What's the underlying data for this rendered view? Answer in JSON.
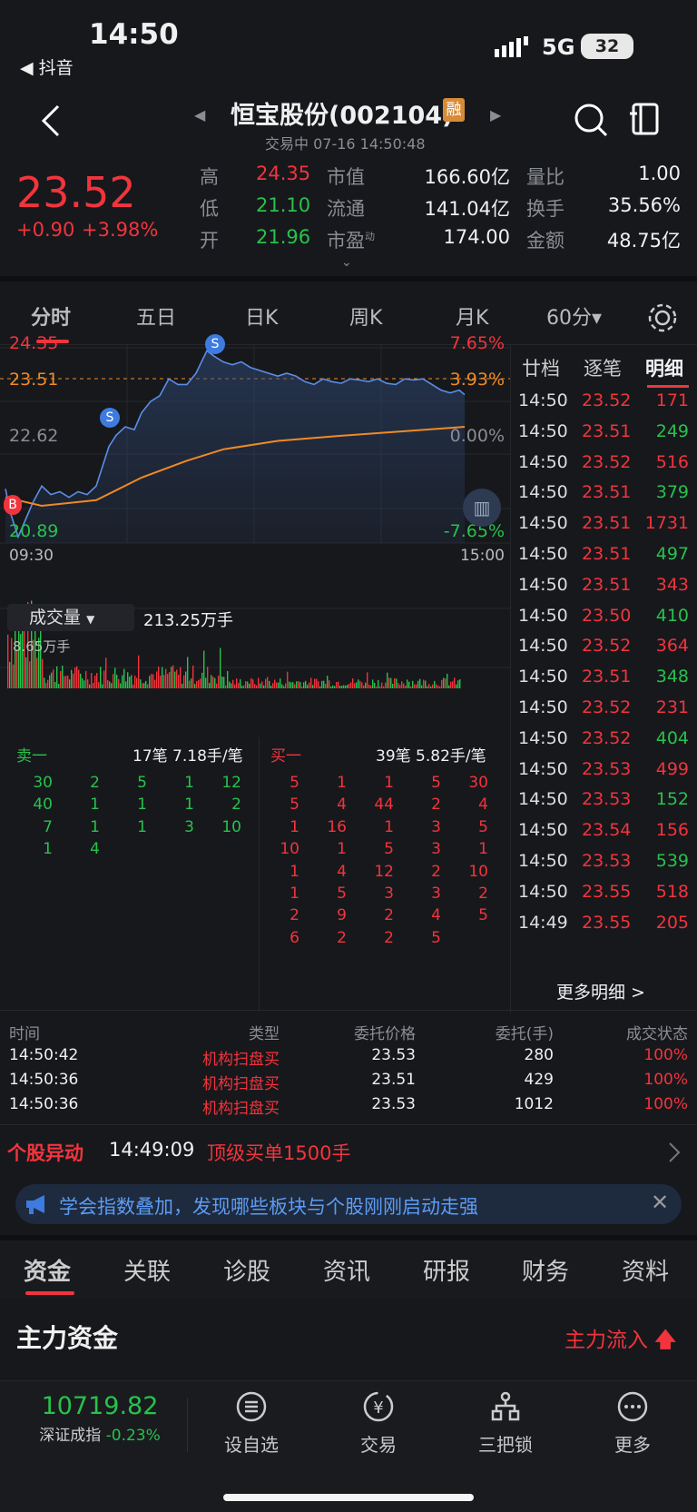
{
  "status_bar": {
    "time": "14:50",
    "back_app": "抖音",
    "network": "5G",
    "battery": "32"
  },
  "nav": {
    "title": "恒宝股份(002104)",
    "badge": "融",
    "subtitle": "交易中 07-16 14:50:48"
  },
  "quote": {
    "price": "23.52",
    "change": "+0.90",
    "change_pct": "+3.98%",
    "stats": [
      {
        "l1": "高",
        "v1": "24.35",
        "l2": "市值",
        "v2": "166.60亿",
        "l3": "量比",
        "v3": "1.00"
      },
      {
        "l1": "低",
        "v1": "21.10",
        "l2": "流通",
        "v2": "141.04亿",
        "l3": "换手",
        "v3": "35.56%"
      },
      {
        "l1": "开",
        "v1": "21.96",
        "l2": "市盈",
        "l2sup": "动",
        "v2": "174.00",
        "l3": "金额",
        "v3": "48.75亿"
      }
    ]
  },
  "chart_tabs": [
    "分时",
    "五日",
    "日K",
    "周K",
    "月K",
    "60分▾"
  ],
  "chart": {
    "price_labels": {
      "high": "24.35",
      "mid": "23.51",
      "base": "22.62",
      "low": "20.89"
    },
    "pct_labels": {
      "high": "7.65%",
      "mid": "3.93%",
      "base": "0.00%",
      "low": "-7.65%"
    },
    "time_start": "09:30",
    "time_end": "15:00",
    "marker_s": "S",
    "marker_b": "B",
    "volume_label": "成交量",
    "volume_value": "213.25万手",
    "volume_max": "8.65万手",
    "colors": {
      "up": "#f2343c",
      "down": "#27c24c",
      "price_line": "#5b8ee6",
      "avg_line": "#f08a24"
    }
  },
  "order_book": {
    "sell_label": "卖一",
    "sell_summary": "17笔 7.18手/笔",
    "buy_label": "买一",
    "buy_summary": "39笔 5.82手/笔",
    "sell_rows": [
      [
        "30",
        "2",
        "5",
        "1",
        "12"
      ],
      [
        "40",
        "1",
        "1",
        "1",
        "2"
      ],
      [
        "7",
        "1",
        "1",
        "3",
        "10"
      ],
      [
        "1",
        "4",
        "",
        "",
        ""
      ]
    ],
    "buy_rows": [
      [
        "5",
        "1",
        "1",
        "5",
        "30"
      ],
      [
        "5",
        "4",
        "44",
        "2",
        "4"
      ],
      [
        "1",
        "16",
        "1",
        "3",
        "5"
      ],
      [
        "10",
        "1",
        "5",
        "3",
        "1"
      ],
      [
        "1",
        "4",
        "12",
        "2",
        "10"
      ],
      [
        "1",
        "5",
        "3",
        "3",
        "2"
      ],
      [
        "2",
        "9",
        "2",
        "4",
        "5"
      ],
      [
        "6",
        "2",
        "2",
        "5",
        ""
      ]
    ]
  },
  "detail_tabs": [
    "廿档",
    "逐笔",
    "明细"
  ],
  "trade_detail": [
    {
      "t": "14:50",
      "p": "23.52",
      "v": "171"
    },
    {
      "t": "14:50",
      "p": "23.51",
      "v": "249"
    },
    {
      "t": "14:50",
      "p": "23.52",
      "v": "516"
    },
    {
      "t": "14:50",
      "p": "23.51",
      "v": "379"
    },
    {
      "t": "14:50",
      "p": "23.51",
      "v": "1731"
    },
    {
      "t": "14:50",
      "p": "23.51",
      "v": "497"
    },
    {
      "t": "14:50",
      "p": "23.51",
      "v": "343"
    },
    {
      "t": "14:50",
      "p": "23.50",
      "v": "410"
    },
    {
      "t": "14:50",
      "p": "23.52",
      "v": "364"
    },
    {
      "t": "14:50",
      "p": "23.51",
      "v": "348"
    },
    {
      "t": "14:50",
      "p": "23.52",
      "v": "231"
    },
    {
      "t": "14:50",
      "p": "23.52",
      "v": "404"
    },
    {
      "t": "14:50",
      "p": "23.53",
      "v": "499"
    },
    {
      "t": "14:50",
      "p": "23.53",
      "v": "152"
    },
    {
      "t": "14:50",
      "p": "23.54",
      "v": "156"
    },
    {
      "t": "14:50",
      "p": "23.53",
      "v": "539"
    },
    {
      "t": "14:50",
      "p": "23.55",
      "v": "518"
    },
    {
      "t": "14:49",
      "p": "23.55",
      "v": "205"
    }
  ],
  "more_detail": "更多明细 >",
  "orders": {
    "headers": [
      "时间",
      "类型",
      "委托价格",
      "委托(手)",
      "成交状态"
    ],
    "rows": [
      [
        "14:50:42",
        "机构扫盘买",
        "23.53",
        "280",
        "100%"
      ],
      [
        "14:50:36",
        "机构扫盘买",
        "23.51",
        "429",
        "100%"
      ],
      [
        "14:50:36",
        "机构扫盘买",
        "23.53",
        "1012",
        "100%"
      ]
    ]
  },
  "alert": {
    "label": "个股异动",
    "time": "14:49:09",
    "text": "顶级买单1500手"
  },
  "banner": {
    "text": "学会指数叠加，发现哪些板块与个股刚刚启动走强"
  },
  "bottom_tabs": [
    "资金",
    "关联",
    "诊股",
    "资讯",
    "研报",
    "财务",
    "资料"
  ],
  "capital": {
    "title": "主力资金",
    "inflow": "主力流入"
  },
  "index": {
    "value": "10719.82",
    "name": "深证成指",
    "change": "-0.23%"
  },
  "bottom_nav": [
    {
      "label": "设自选",
      "icon": "menu-icon"
    },
    {
      "label": "交易",
      "icon": "yen-icon"
    },
    {
      "label": "三把锁",
      "icon": "network-icon"
    },
    {
      "label": "更多",
      "icon": "more-icon"
    }
  ]
}
